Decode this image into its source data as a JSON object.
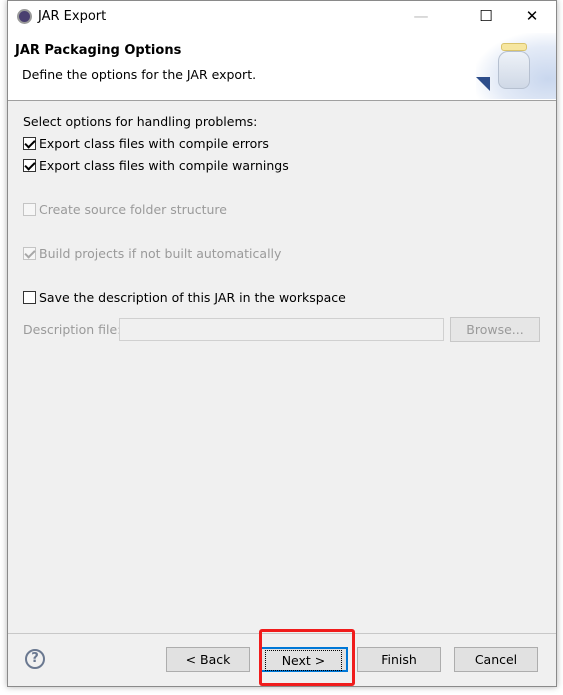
{
  "window": {
    "title": "JAR Export",
    "minimize": "—",
    "maximize": "☐",
    "close": "✕"
  },
  "header": {
    "title": "JAR Packaging Options",
    "description": "Define the options for the JAR export."
  },
  "options": {
    "section_label": "Select options for handling problems:",
    "export_errors": {
      "label": "Export class files with compile errors",
      "checked": true,
      "enabled": true
    },
    "export_warnings": {
      "label": "Export class files with compile warnings",
      "checked": true,
      "enabled": true
    },
    "create_source_folder": {
      "label": "Create source folder structure",
      "checked": false,
      "enabled": false
    },
    "build_projects": {
      "label": "Build projects if not built automatically",
      "checked": true,
      "enabled": false
    },
    "save_description": {
      "label": "Save the description of this JAR in the workspace",
      "checked": false,
      "enabled": true
    },
    "description_file_label": "Description file:",
    "description_file_value": "",
    "browse_label": "Browse..."
  },
  "footer": {
    "help": "?",
    "back": "< Back",
    "next": "Next >",
    "finish": "Finish",
    "cancel": "Cancel",
    "highlight_color": "#f01c1c"
  }
}
